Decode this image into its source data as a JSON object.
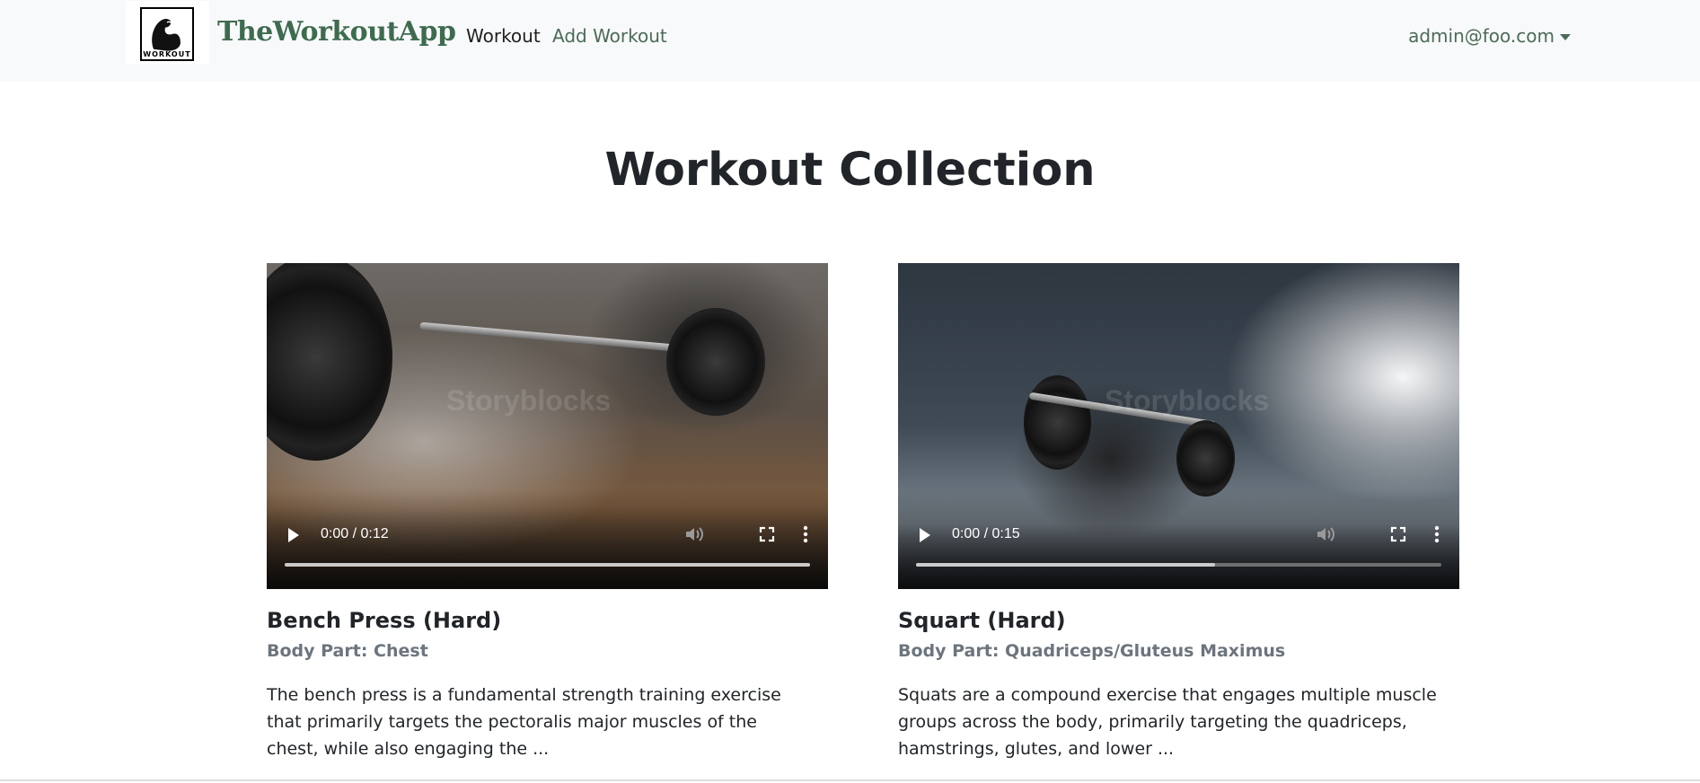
{
  "navbar": {
    "logo_text": "WORKOUT",
    "brand": "TheWorkoutApp",
    "links": [
      {
        "label": "Workout",
        "active": true
      },
      {
        "label": "Add Workout",
        "active": false
      }
    ],
    "user": "admin@foo.com"
  },
  "main": {
    "title": "Workout Collection",
    "cards": [
      {
        "title": "Bench Press (Hard)",
        "body_part": "Body Part: Chest",
        "description": "The bench press is a fundamental strength training exercise that primarily targets the pectoralis major muscles of the chest, while also engaging the ...",
        "video": {
          "time": "0:00 / 0:12",
          "progress": 1.0,
          "watermark": "Storyblocks"
        }
      },
      {
        "title": "Squart (Hard)",
        "body_part": "Body Part: Quadriceps/Gluteus Maximus",
        "description": "Squats are a compound exercise that engages multiple muscle groups across the body, primarily targeting the quadriceps, hamstrings, glutes, and lower ...",
        "video": {
          "time": "0:00 / 0:15",
          "progress": 0.57,
          "watermark": "Storyblocks"
        }
      }
    ]
  },
  "colors": {
    "brand": "#3e6b4f",
    "nav_bg": "#f8f9fa",
    "muted": "#6c757d"
  },
  "icons": [
    "play-icon",
    "volume-icon",
    "fullscreen-icon",
    "more-options-icon",
    "caret-down-icon"
  ]
}
